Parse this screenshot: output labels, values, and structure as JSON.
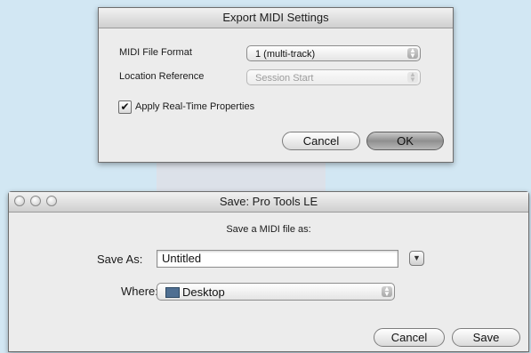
{
  "export_dialog": {
    "title": "Export MIDI Settings",
    "format_label": "MIDI File Format",
    "format_value": "1 (multi-track)",
    "location_label": "Location Reference",
    "location_value": "Session Start",
    "apply_label": "Apply Real-Time Properties",
    "apply_checked": true,
    "cancel_label": "Cancel",
    "ok_label": "OK"
  },
  "save_dialog": {
    "title": "Save: Pro Tools LE",
    "prompt": "Save a MIDI file as:",
    "save_as_label": "Save As:",
    "save_as_value": "Untitled",
    "where_label": "Where:",
    "where_value": "Desktop",
    "cancel_label": "Cancel",
    "save_label": "Save"
  },
  "icons": [
    "checkmark-icon",
    "popup-arrows-icon",
    "disclosure-triangle-icon",
    "desktop-icon",
    "window-close-icon",
    "window-minimize-icon",
    "window-zoom-icon"
  ],
  "colors": {
    "background": "#d2e7f3",
    "dialog": "#ececec"
  }
}
